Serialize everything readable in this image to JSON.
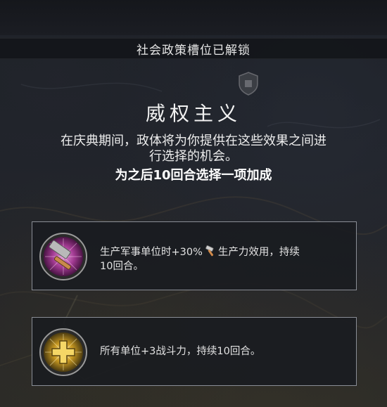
{
  "banner": {
    "text": "社会政策槽位已解锁"
  },
  "title": "威权主义",
  "description": {
    "line1": "在庆典期间，政体将为你提供在这些效果之间进",
    "line2": "行选择的机会。",
    "emphasis": "为之后10回合选择一项加成"
  },
  "options": [
    {
      "icon": "hammer-icon",
      "text_before": "生产军事单位时+30%",
      "inline_icon": "production-hammer-icon",
      "text_after": "生产力效用，持续",
      "text_line2": "10回合。"
    },
    {
      "icon": "plus-cross-icon",
      "text": "所有单位+3战斗力，持续10回合。"
    }
  ],
  "colors": {
    "panel_border": "#8a8e96",
    "panel_bg": "#1a1c20",
    "icon1_ring": "#c84fb5",
    "icon2_ring": "#d9b030"
  }
}
